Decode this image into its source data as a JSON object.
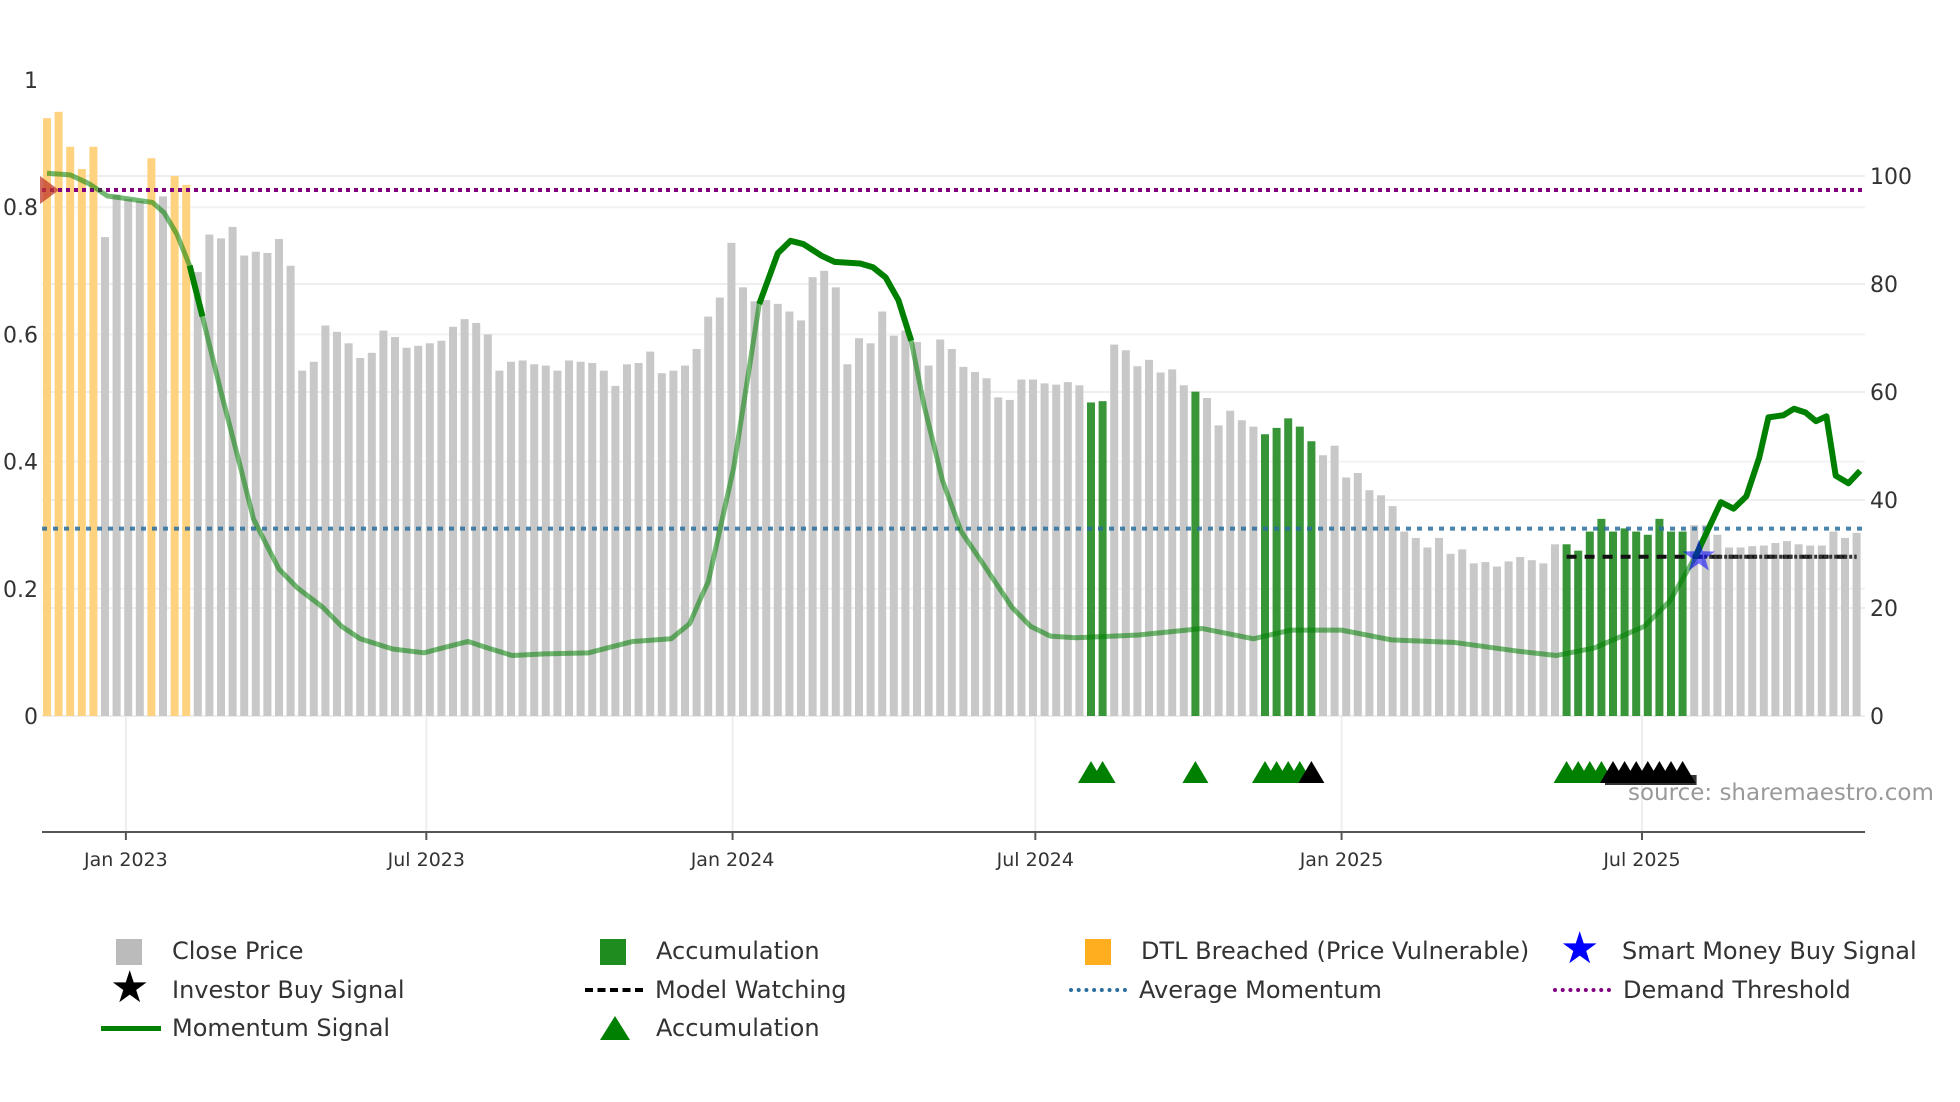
{
  "chart_data": {
    "type": "bar",
    "title": "",
    "left_axis": {
      "ticks": [
        "0",
        "0.2",
        "0.4",
        "0.6",
        "0.8",
        "1"
      ],
      "range": [
        0,
        1
      ]
    },
    "right_axis": {
      "ticks": [
        "0",
        "20",
        "40",
        "60",
        "80",
        "100"
      ],
      "range": [
        0,
        100
      ]
    },
    "x_ticks": [
      {
        "label": "Jan 2023",
        "week": 6.8
      },
      {
        "label": "Jul 2023",
        "week": 32.7
      },
      {
        "label": "Jan 2024",
        "week": 59.1
      },
      {
        "label": "Jul 2024",
        "week": 85.2
      },
      {
        "label": "Jan 2025",
        "week": 111.6
      },
      {
        "label": "Jul 2025",
        "week": 137.5
      }
    ],
    "close_price": [
      0.94,
      0.95,
      0.895,
      0.86,
      0.895,
      0.753,
      0.82,
      0.813,
      0.81,
      0.877,
      0.817,
      0.849,
      0.835,
      0.698,
      0.757,
      0.751,
      0.769,
      0.724,
      0.73,
      0.728,
      0.75,
      0.708,
      0.543,
      0.557,
      0.614,
      0.604,
      0.586,
      0.563,
      0.571,
      0.606,
      0.596,
      0.579,
      0.582,
      0.586,
      0.59,
      0.612,
      0.624,
      0.618,
      0.6,
      0.543,
      0.557,
      0.559,
      0.553,
      0.551,
      0.543,
      0.559,
      0.557,
      0.555,
      0.543,
      0.519,
      0.553,
      0.555,
      0.573,
      0.539,
      0.543,
      0.551,
      0.577,
      0.628,
      0.658,
      0.744,
      0.674,
      0.652,
      0.654,
      0.648,
      0.636,
      0.622,
      0.69,
      0.7,
      0.674,
      0.553,
      0.594,
      0.586,
      0.636,
      0.598,
      0.606,
      0.588,
      0.551,
      0.592,
      0.577,
      0.549,
      0.541,
      0.531,
      0.501,
      0.497,
      0.529,
      0.529,
      0.523,
      0.521,
      0.525,
      0.52,
      0.493,
      0.495,
      0.584,
      0.575,
      0.55,
      0.56,
      0.54,
      0.545,
      0.52,
      0.51,
      0.5,
      0.457,
      0.48,
      0.465,
      0.455,
      0.443,
      0.453,
      0.468,
      0.455,
      0.432,
      0.41,
      0.425,
      0.375,
      0.382,
      0.355,
      0.347,
      0.33,
      0.29,
      0.28,
      0.265,
      0.28,
      0.255,
      0.262,
      0.24,
      0.242,
      0.235,
      0.243,
      0.25,
      0.245,
      0.24,
      0.27,
      0.27,
      0.26,
      0.29,
      0.31,
      0.29,
      0.295,
      0.29,
      0.285,
      0.31,
      0.29,
      0.29,
      0.3,
      0.3,
      0.285,
      0.265,
      0.265,
      0.267,
      0.268,
      0.272,
      0.275,
      0.27,
      0.268,
      0.268,
      0.29,
      0.28,
      0.288
    ],
    "dtl_breached_weeks": [
      0,
      1,
      2,
      3,
      4,
      9,
      11,
      12
    ],
    "accumulation_weeks": [
      90,
      91,
      99,
      105,
      106,
      107,
      108,
      109,
      131,
      132,
      133,
      134,
      135,
      136,
      137,
      138,
      139,
      140,
      141
    ],
    "momentum_signal": [
      [
        0,
        100.5
      ],
      [
        2,
        100.2
      ],
      [
        3.6,
        98.6
      ],
      [
        5.2,
        96.3
      ],
      [
        6.9,
        95.8
      ],
      [
        9.1,
        95.1
      ],
      [
        10.1,
        93.2
      ],
      [
        11.2,
        89.2
      ],
      [
        12.3,
        83.4
      ],
      [
        13.4,
        74
      ],
      [
        15,
        60
      ],
      [
        16.7,
        45.9
      ],
      [
        17.8,
        36.5
      ],
      [
        18.9,
        31.8
      ],
      [
        20,
        27.2
      ],
      [
        21.6,
        23.7
      ],
      [
        23.8,
        20.1
      ],
      [
        25.4,
        16.6
      ],
      [
        27,
        14.3
      ],
      [
        29.8,
        12.4
      ],
      [
        32.5,
        11.7
      ],
      [
        34.1,
        12.6
      ],
      [
        36.3,
        13.8
      ],
      [
        38,
        12.6
      ],
      [
        40.1,
        11.2
      ],
      [
        42.9,
        11.5
      ],
      [
        46.7,
        11.7
      ],
      [
        48.3,
        12.6
      ],
      [
        50.5,
        13.8
      ],
      [
        53.8,
        14.3
      ],
      [
        55.4,
        17.1
      ],
      [
        56.5,
        22.5
      ],
      [
        57,
        24.8
      ],
      [
        59.2,
        46
      ],
      [
        61.4,
        76.3
      ],
      [
        63,
        85.7
      ],
      [
        64.1,
        88
      ],
      [
        65.2,
        87.4
      ],
      [
        66.8,
        85.2
      ],
      [
        67.9,
        84.1
      ],
      [
        70.1,
        83.8
      ],
      [
        71.2,
        83.1
      ],
      [
        72.3,
        81.2
      ],
      [
        73.4,
        77
      ],
      [
        74.5,
        69.5
      ],
      [
        75.6,
        57.6
      ],
      [
        77.2,
        43.6
      ],
      [
        78.8,
        34.2
      ],
      [
        81,
        27.2
      ],
      [
        83.2,
        20.1
      ],
      [
        84.8,
        16.6
      ],
      [
        86.5,
        14.8
      ],
      [
        88.7,
        14.5
      ],
      [
        94.1,
        15
      ],
      [
        99.6,
        16.2
      ],
      [
        104,
        14.3
      ],
      [
        107.2,
        15.9
      ],
      [
        111.6,
        15.9
      ],
      [
        115.9,
        14.1
      ],
      [
        121.4,
        13.6
      ],
      [
        126.8,
        12
      ],
      [
        130.1,
        11.2
      ],
      [
        133.4,
        12.6
      ],
      [
        137.7,
        16.6
      ],
      [
        139.9,
        21.3
      ],
      [
        142.1,
        29.5
      ],
      [
        144.3,
        39.6
      ],
      [
        145.4,
        38.4
      ],
      [
        146.5,
        40.7
      ],
      [
        147.6,
        47.8
      ],
      [
        148.4,
        55.3
      ],
      [
        149.7,
        55.7
      ],
      [
        150.6,
        56.9
      ],
      [
        151.6,
        56.2
      ],
      [
        152.5,
        54.6
      ],
      [
        153.4,
        55.5
      ],
      [
        154.2,
        44.5
      ],
      [
        155.3,
        43.1
      ],
      [
        156.3,
        45.4
      ]
    ],
    "momentum_emphasized_ranges": [
      [
        12,
        13.4
      ],
      [
        60.5,
        75
      ],
      [
        142,
        157
      ]
    ],
    "average_momentum": 34.7,
    "demand_threshold": 97.4,
    "model_watching": {
      "value": 29.5,
      "from_week": 131,
      "to_week": 156
    },
    "smart_money_buy_signal": [
      {
        "week": 142.4,
        "value": 29.5
      }
    ],
    "start_marker": {
      "week": 0,
      "value": 97.4
    },
    "accumulation_triangles": [
      90,
      91,
      99,
      105,
      106,
      107,
      108,
      131,
      132,
      133,
      134
    ],
    "investor_buy_triangles": [
      109,
      135,
      136,
      137,
      138,
      139,
      140,
      141
    ],
    "colors": {
      "close": "#c8c8c8",
      "accumulation": "#228b22",
      "dtl": "#ffd27f",
      "momentum": "#008000",
      "avg": "#2b6e9e",
      "threshold": "#800080",
      "smart": "#0000ff"
    }
  },
  "legend": [
    {
      "label": "Close Price",
      "icon": "square-gray"
    },
    {
      "label": "Accumulation",
      "icon": "square-green"
    },
    {
      "label": "DTL Breached (Price Vulnerable)",
      "icon": "square-orange"
    },
    {
      "label": "Smart Money Buy Signal",
      "icon": "star-blue"
    },
    {
      "label": "Investor Buy Signal",
      "icon": "star-black"
    },
    {
      "label": "Model Watching",
      "icon": "dash-black"
    },
    {
      "label": "Average Momentum",
      "icon": "dot-blue"
    },
    {
      "label": "Demand Threshold",
      "icon": "dot-purple"
    },
    {
      "label": "Momentum Signal",
      "icon": "line-green"
    },
    {
      "label": "Accumulation",
      "icon": "triangle-green"
    }
  ],
  "source": "source: sharemaestro.com"
}
